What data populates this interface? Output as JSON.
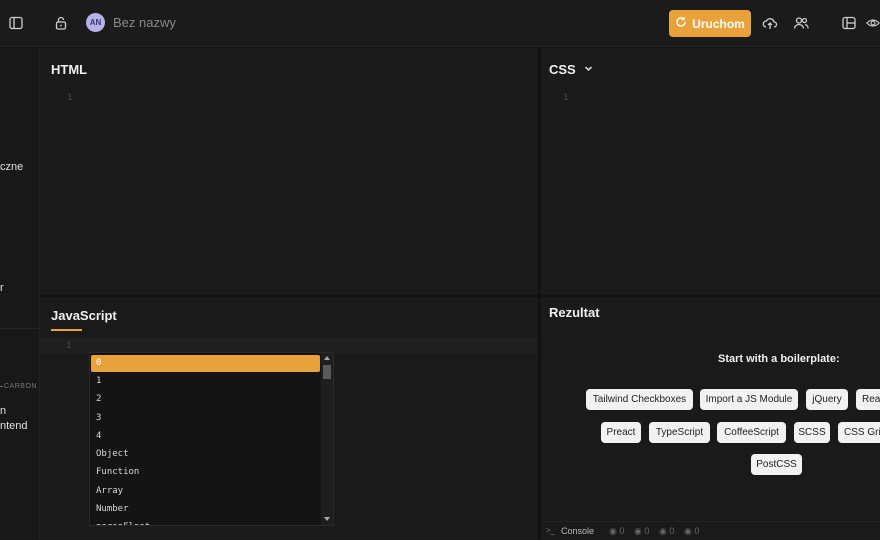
{
  "topbar": {
    "avatar_initials": "AN",
    "project_name": "Bez nazwy",
    "run_label": "Uruchom",
    "colors": {
      "accent": "#e9a23b"
    },
    "icons": [
      "sidebar-toggle-icon",
      "lock-icon",
      "refresh-icon",
      "cloud-upload-icon",
      "users-icon",
      "layout-icon",
      "eye-icon"
    ]
  },
  "sidebar": {
    "label_czne": "czne",
    "label_r": "r",
    "section_carbon": "CARBON",
    "label_n": "n",
    "label_ntend": "ntend"
  },
  "editors": {
    "html": {
      "title": "HTML",
      "line": "1"
    },
    "css": {
      "title": "CSS",
      "line": "1"
    },
    "js": {
      "title": "JavaScript",
      "line": "1"
    }
  },
  "autocomplete": {
    "items": [
      "0",
      "1",
      "2",
      "3",
      "4",
      "Object",
      "Function",
      "Array",
      "Number",
      "parseFloat"
    ]
  },
  "result": {
    "title": "Rezultat",
    "boilerplate_title": "Start with a boilerplate:",
    "chips": [
      "Tailwind Checkboxes",
      "Import a JS Module",
      "jQuery",
      "React",
      "Preact",
      "TypeScript",
      "CoffeeScript",
      "SCSS",
      "CSS Grid",
      "PostCSS"
    ]
  },
  "console": {
    "label": "Console",
    "counts": [
      "0",
      "0",
      "0",
      "0"
    ]
  }
}
